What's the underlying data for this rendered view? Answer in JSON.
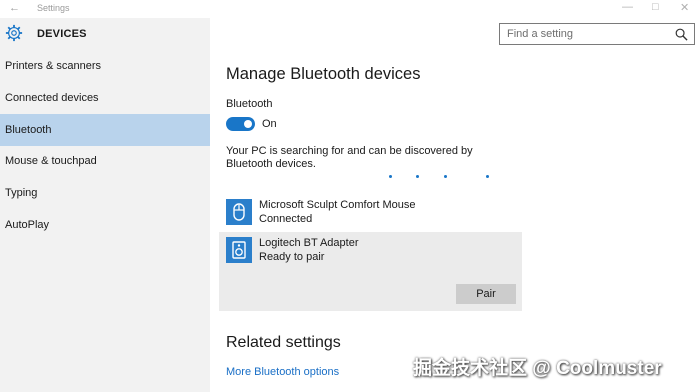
{
  "window": {
    "title": "Settings",
    "back_glyph": "←",
    "minimize_glyph": "—",
    "maximize_glyph": "□",
    "close_glyph": "✕"
  },
  "header": {
    "section_title": "DEVICES",
    "icon": "gear-icon"
  },
  "search": {
    "placeholder": "Find a setting",
    "icon": "search-icon"
  },
  "sidebar": {
    "items": [
      {
        "label": "Printers & scanners",
        "selected": false
      },
      {
        "label": "Connected devices",
        "selected": false
      },
      {
        "label": "Bluetooth",
        "selected": true
      },
      {
        "label": "Mouse & touchpad",
        "selected": false
      },
      {
        "label": "Typing",
        "selected": false
      },
      {
        "label": "AutoPlay",
        "selected": false
      }
    ],
    "selected_color": "#b9d3ec"
  },
  "main": {
    "title": "Manage Bluetooth devices",
    "bluetooth_label": "Bluetooth",
    "toggle": {
      "state": "on",
      "label": "On",
      "color": "#1976c8"
    },
    "searching_text": "Your PC is searching for and can be discovered by Bluetooth devices.",
    "devices": [
      {
        "name": "Microsoft Sculpt Comfort Mouse",
        "status": "Connected",
        "icon": "mouse-icon"
      },
      {
        "name": "Logitech BT Adapter",
        "status": "Ready to pair",
        "icon": "speaker-icon",
        "action": "Pair"
      }
    ],
    "related": {
      "title": "Related settings",
      "link": "More Bluetooth options"
    }
  },
  "watermark": "掘金技术社区 @ Coolmuster",
  "colors": {
    "accent": "#1976c8",
    "link": "#1a6fc6",
    "sidebar_bg": "#f2f2f2"
  }
}
